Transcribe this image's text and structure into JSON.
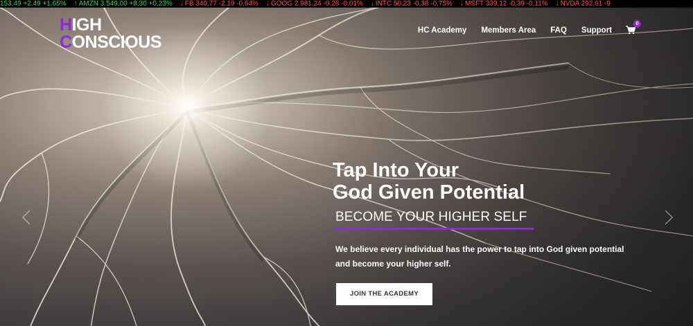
{
  "ticker": [
    {
      "text": "153,49 +2,49 +1,65%",
      "dir": "up",
      "arrow": false
    },
    {
      "text": "AMZN 3.549,00 +8,30 +0,23%",
      "dir": "up",
      "arrow": true
    },
    {
      "text": "FB 340,77 -2,19 -0,64%",
      "dir": "down",
      "arrow": true
    },
    {
      "text": "GOOG 2.981,24 -0,28 -0,01%",
      "dir": "down",
      "arrow": true
    },
    {
      "text": "INTC 50,23 -0,38 -0,75%",
      "dir": "down",
      "arrow": true
    },
    {
      "text": "MSFT 339,12 -0,39 -0,11%",
      "dir": "down",
      "arrow": true
    },
    {
      "text": "NVDA 292,61 -9",
      "dir": "down",
      "arrow": true
    }
  ],
  "logo": {
    "line1_initial": "H",
    "line1_rest": "IGH",
    "line2_initial": "C",
    "line2_rest": "ONSCIOUS"
  },
  "nav": {
    "items": [
      "HC Academy",
      "Members Area",
      "FAQ",
      "Support"
    ],
    "cart_count": "0",
    "cart_icon": "shopping-cart-icon"
  },
  "hero": {
    "headline_line1": "Tap Into Your",
    "headline_line2": "God Given Potential",
    "subheading": "BECOME YOUR HIGHER SELF",
    "description": "We believe every individual has the power to tap into God given potential and become your higher self.",
    "cta_label": "JOIN THE ACADEMY"
  },
  "colors": {
    "accent": "#8d2bd6",
    "ticker_up": "#2bd45a",
    "ticker_down": "#ff4d4d"
  }
}
